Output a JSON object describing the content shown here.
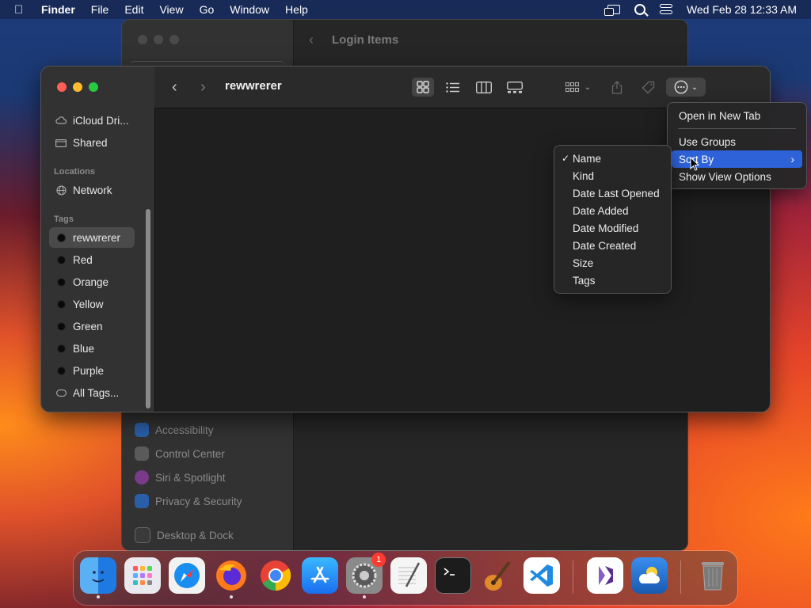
{
  "menubar": {
    "app": "Finder",
    "items": [
      "File",
      "Edit",
      "View",
      "Go",
      "Window",
      "Help"
    ],
    "clock": "Wed Feb 28  12:33 AM"
  },
  "background_window": {
    "title": "Login Items",
    "sidebar_items": [
      "Accessibility",
      "Control Center",
      "Siri & Spotlight",
      "Privacy & Security",
      "Desktop & Dock"
    ]
  },
  "finder": {
    "folder_title": "rewwrerer",
    "sidebar": {
      "favorites": [
        "iCloud Dri...",
        "Shared"
      ],
      "locations_header": "Locations",
      "locations": [
        "Network"
      ],
      "tags_header": "Tags",
      "tags": [
        "rewwrerer",
        "Red",
        "Orange",
        "Yellow",
        "Green",
        "Blue",
        "Purple"
      ],
      "all_tags": "All Tags..."
    }
  },
  "more_menu": {
    "items": [
      "Open in New Tab",
      "Use Groups",
      "Sort By",
      "Show View Options"
    ],
    "highlighted": "Sort By"
  },
  "sort_menu": {
    "items": [
      "Name",
      "Kind",
      "Date Last Opened",
      "Date Added",
      "Date Modified",
      "Date Created",
      "Size",
      "Tags"
    ],
    "checked": "Name",
    "check_mark": "✓"
  },
  "dock": {
    "apps": [
      "finder",
      "launchpad",
      "safari",
      "firefox",
      "chrome",
      "app-store",
      "system-settings",
      "textedit",
      "terminal",
      "garageband",
      "vscode",
      "visual-studio",
      "weather",
      "trash"
    ],
    "settings_badge": "1"
  },
  "colors": {
    "highlight": "#2d62d8",
    "traffic_red": "#ff5f57",
    "traffic_yellow": "#febc2e",
    "traffic_green": "#28c840"
  }
}
